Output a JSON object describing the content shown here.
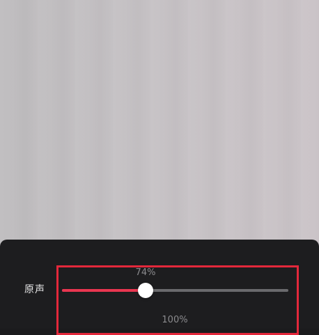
{
  "colors": {
    "accent": "#ea3650",
    "highlight": "#e3283b",
    "panel": "#1d1d1f"
  },
  "volume_panel": {
    "original_sound": {
      "label": "原声",
      "value_text": "74%",
      "level": 0.74
    },
    "next_value_text": "100%"
  }
}
